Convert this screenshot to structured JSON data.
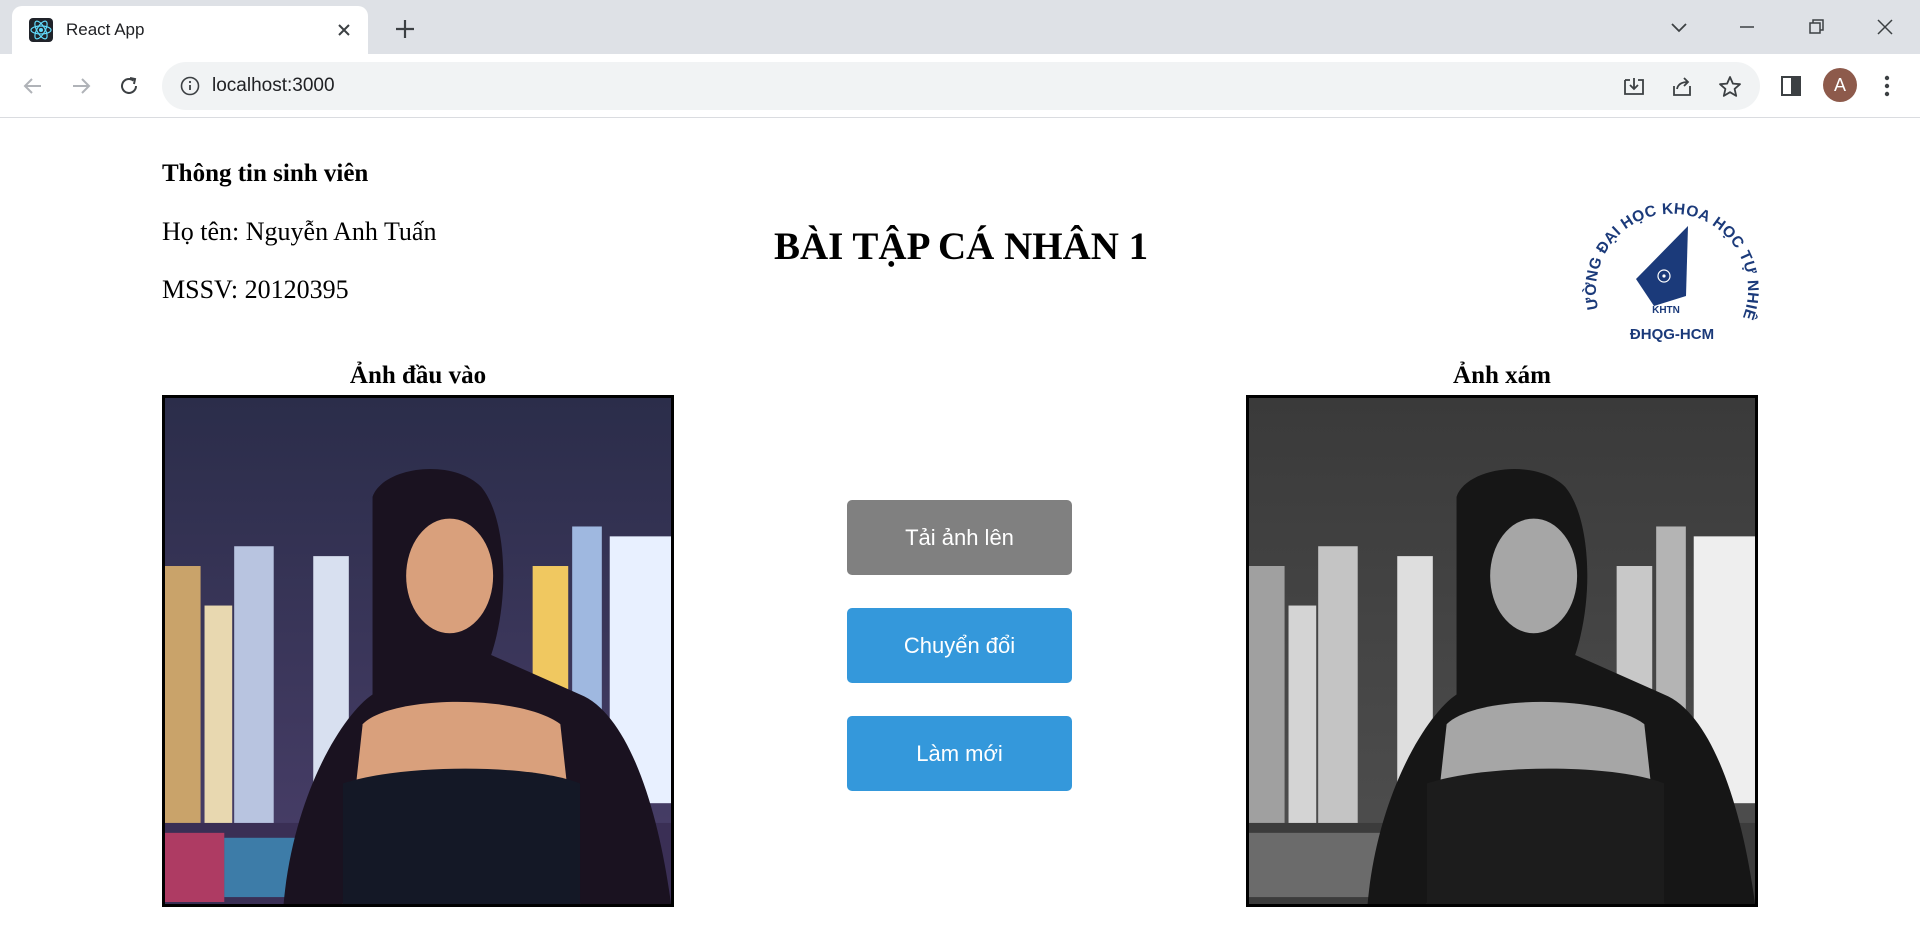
{
  "browser": {
    "tab_title": "React App",
    "url": "localhost:3000",
    "profile_initial": "A",
    "icons": [
      "react-favicon-icon",
      "close-icon",
      "plus-icon",
      "chevron-down-icon",
      "minimize-icon",
      "restore-icon",
      "close-window-icon",
      "back-arrow-icon",
      "forward-arrow-icon",
      "reload-icon",
      "info-icon",
      "install-icon",
      "share-icon",
      "star-icon",
      "side-panel-icon",
      "more-vert-icon"
    ]
  },
  "student": {
    "heading": "Thông tin sinh viên",
    "name": "Họ tên: Nguyễn Anh Tuấn",
    "id": "MSSV: 20120395"
  },
  "page_title": "BÀI TẬP CÁ NHÂN 1",
  "logo": {
    "arc_text": "TRƯỜNG ĐẠI HỌC KHOA HỌC TỰ NHIÊN",
    "inner_text": "KHTN",
    "bottom_text": "ĐHQG-HCM",
    "color": "#1b3a7a"
  },
  "input_image": {
    "label": "Ảnh đầu vào"
  },
  "output_image": {
    "label": "Ảnh xám"
  },
  "buttons": {
    "upload": "Tải ảnh lên",
    "convert": "Chuyển đổi",
    "reset": "Làm mới"
  },
  "colors": {
    "upload_button": "#808080",
    "primary_button": "#3498db"
  }
}
